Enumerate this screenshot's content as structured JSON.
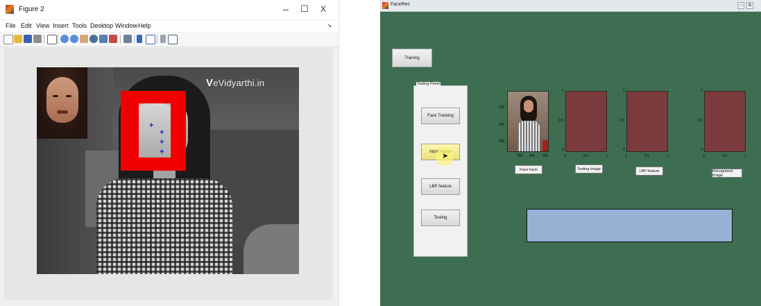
{
  "figure_window": {
    "title": "Figure 2",
    "controls": {
      "minimize": "–",
      "maximize": "☐",
      "close": "X"
    },
    "menu": [
      "File",
      "Edit",
      "View",
      "Insert",
      "Tools",
      "Desktop",
      "Window",
      "Help"
    ],
    "dock_arrow": "↘",
    "toolbar_icons": [
      "new-figure-icon",
      "open-file-icon",
      "save-icon",
      "print-icon",
      "pointer-icon",
      "zoom-in-icon",
      "zoom-out-icon",
      "pan-icon",
      "rotate-3d-icon",
      "data-cursor-icon",
      "brush-icon",
      "link-icon",
      "colorbar-icon",
      "legend-icon",
      "hide-plot-tools-icon",
      "show-plot-tools-icon"
    ],
    "watermark": {
      "v": "V",
      "text": "eVidyarthi.in"
    },
    "markers": [
      "+",
      "+",
      "+",
      "+"
    ]
  },
  "facerec_window": {
    "title": "FaceRec",
    "controls": {
      "minimize": "▭",
      "restore": "⧉"
    },
    "buttons": {
      "training": "Training",
      "face_tracking": "Face Tracking",
      "input_image": "Input Image",
      "lbp_feature": "LBP feature",
      "testing": "Testing"
    },
    "testing_panel_title": "Testing Panel",
    "axes": {
      "face_track": {
        "label": "Face track",
        "y_ticks": [
          "100",
          "200",
          "300"
        ],
        "x_ticks": [
          "200",
          "400",
          "600"
        ]
      },
      "testing_image": {
        "label": "Testing image",
        "y_ticks": [
          "1",
          "0.5",
          "0"
        ],
        "x_ticks": [
          "0",
          "0.5",
          "1"
        ]
      },
      "lbp_feature": {
        "label": "LBP feature",
        "y_ticks": [
          "1",
          "0.5",
          "0"
        ],
        "x_ticks": [
          "0",
          "0.5",
          "1"
        ]
      },
      "recognized_image": {
        "label": "Recognized image",
        "y_ticks": [
          "1",
          "0.5",
          "0"
        ],
        "x_ticks": [
          "0",
          "0.5",
          "1"
        ]
      }
    },
    "colors": {
      "background": "#3d6e51",
      "axes_fill": "#7b3a3c",
      "result_box": "#97b1d4"
    }
  }
}
